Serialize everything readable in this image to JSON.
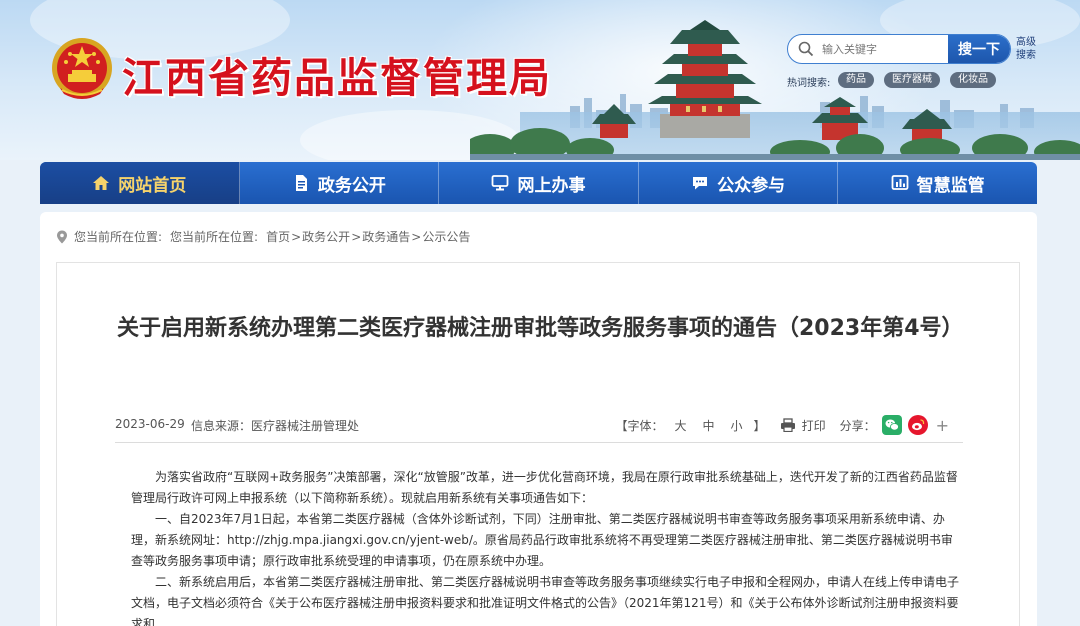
{
  "header": {
    "site_title": "江西省药品监督管理局",
    "search": {
      "placeholder": "输入关键字",
      "button_label": "搜一下",
      "advanced_label": "高级搜索"
    },
    "hot_search_label": "热词搜索:",
    "hot_tags": [
      "药品",
      "医疗器械",
      "化妆品"
    ]
  },
  "nav": {
    "items": [
      {
        "label": "网站首页",
        "icon": "home-icon",
        "active": true
      },
      {
        "label": "政务公开",
        "icon": "document-icon",
        "active": false
      },
      {
        "label": "网上办事",
        "icon": "monitor-icon",
        "active": false
      },
      {
        "label": "公众参与",
        "icon": "chat-icon",
        "active": false
      },
      {
        "label": "智慧监管",
        "icon": "chart-icon",
        "active": false
      }
    ]
  },
  "breadcrumb": {
    "prefix": "您当前所在位置:",
    "items": [
      "首页",
      "政务公开",
      "政务通告",
      "公示公告"
    ],
    "separator": ">"
  },
  "article": {
    "title": "关于启用新系统办理第二类医疗器械注册审批等政务服务事项的通告（2023年第4号）",
    "date": "2023-06-29",
    "source": "信息来源：医疗器械注册管理处",
    "font_label": "【字体：",
    "font_sizes": [
      "大",
      "中",
      "小"
    ],
    "font_close": "】",
    "print_label": "打印",
    "share_label": "分享：",
    "share_more": "+",
    "paragraphs": [
      "为落实省政府“互联网+政务服务”决策部署，深化“放管服”改革，进一步优化营商环境，我局在原行政审批系统基础上，迭代开发了新的江西省药品监督管理局行政许可网上申报系统（以下简称新系统）。现就启用新系统有关事项通告如下：",
      "一、自2023年7月1日起，本省第二类医疗器械（含体外诊断试剂，下同）注册审批、第二类医疗器械说明书审查等政务服务事项采用新系统申请、办理，新系统网址：http://zhjg.mpa.jiangxi.gov.cn/yjent-web/。原省局药品行政审批系统将不再受理第二类医疗器械注册审批、第二类医疗器械说明书审查等政务服务事项申请；原行政审批系统受理的申请事项，仍在原系统中办理。",
      "二、新系统启用后，本省第二类医疗器械注册审批、第二类医疗器械说明书审查等政务服务事项继续实行电子申报和全程网办，申请人在线上传申请电子文档，电子文档必须符合《关于公布医疗器械注册申报资料要求和批准证明文件格式的公告》（2021年第121号）和《关于公布体外诊断试剂注册申报资料要求和"
    ]
  },
  "colors": {
    "title_red": "#d5111d",
    "nav_blue": "#1a55b0",
    "nav_active_text": "#f6d36b",
    "wechat_green": "#2aae67",
    "weibo_red": "#e6162d"
  }
}
